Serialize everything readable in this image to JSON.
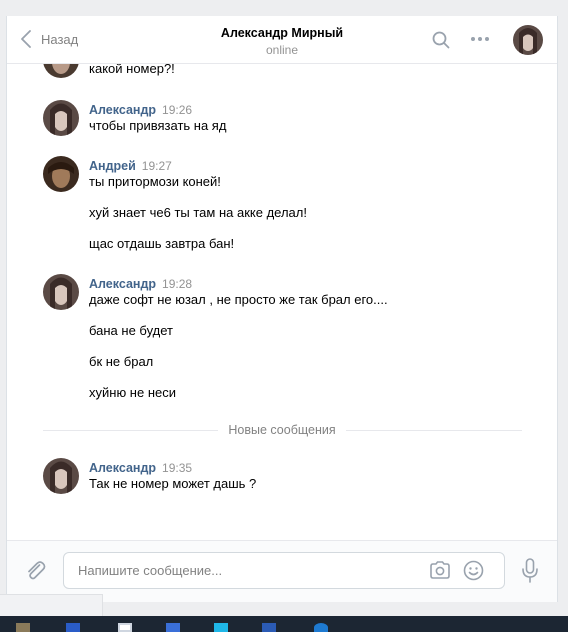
{
  "header": {
    "back_label": "Назад",
    "peer_name": "Александр Мирный",
    "peer_status": "online"
  },
  "history": {
    "partial_message": "какой номер?!",
    "messages": [
      {
        "author": "Александр",
        "time": "19:26",
        "lines": [
          "чтобы привязать на яд"
        ]
      },
      {
        "author": "Андрей",
        "time": "19:27",
        "lines": [
          "ты притормози коней!",
          "хуй знает че6 ты там на акке делал!",
          "щас отдашь завтра бан!"
        ]
      },
      {
        "author": "Александр",
        "time": "19:28",
        "lines": [
          "даже софт не юзал , не просто же так брал его....",
          "бана не будет",
          "бк не брал",
          "хуйню не неси"
        ]
      },
      {
        "author": "Александр",
        "time": "19:35",
        "lines": [
          "Так не номер может дашь ?"
        ]
      }
    ],
    "new_messages_label": "Новые сообщения"
  },
  "composer": {
    "placeholder": "Напишите сообщение..."
  },
  "icons": {
    "back": "chevron-left-icon",
    "search": "search-icon",
    "more": "more-dots-icon",
    "attach": "paperclip-icon",
    "camera": "camera-icon",
    "emoji": "smile-icon",
    "voice": "microphone-icon"
  },
  "colors": {
    "author": "#42648b",
    "muted": "#939393",
    "taskbar": "#1c2633"
  }
}
